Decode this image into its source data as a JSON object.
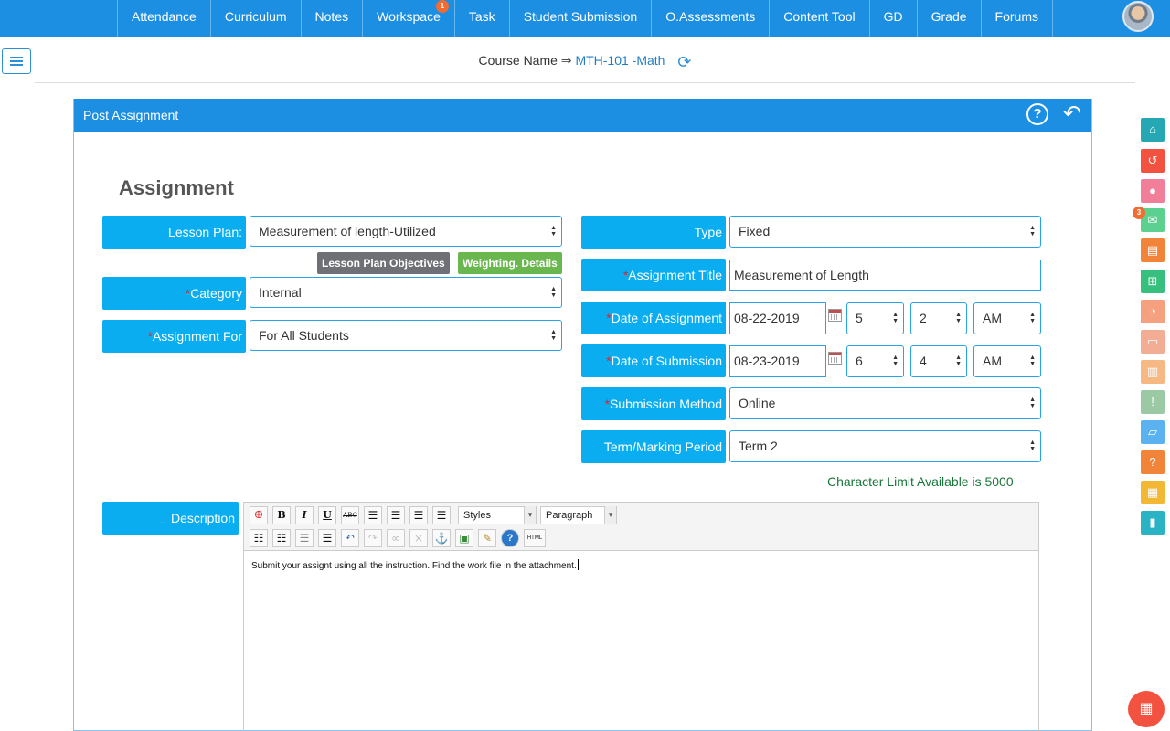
{
  "nav": {
    "items": [
      {
        "label": "Attendance"
      },
      {
        "label": "Curriculum"
      },
      {
        "label": "Notes"
      },
      {
        "label": "Workspace",
        "badge": "1"
      },
      {
        "label": "Task"
      },
      {
        "label": "Student Submission"
      },
      {
        "label": "O.Assessments"
      },
      {
        "label": "Content Tool"
      },
      {
        "label": "GD"
      },
      {
        "label": "Grade"
      },
      {
        "label": "Forums"
      }
    ],
    "avatar_icon": "user-avatar"
  },
  "course": {
    "label": "Course Name ⇒",
    "value": "MTH-101 -Math",
    "refresh_icon": "refresh-icon"
  },
  "panel": {
    "title": "Post Assignment",
    "help": "?",
    "back": "↶"
  },
  "section_title": "Assignment",
  "form": {
    "lesson_plan": {
      "label": "Lesson Plan:",
      "value": "Measurement of length-Utilized"
    },
    "objectives_tag": "Lesson Plan Objectives",
    "weighting_tag": "Weighting. Details",
    "category": {
      "required": "*",
      "label": "Category",
      "value": "Internal"
    },
    "assignment_for": {
      "required": "*",
      "label": "Assignment For",
      "value": "For All Students"
    },
    "type": {
      "label": "Type",
      "value": "Fixed"
    },
    "assignment_title": {
      "required": "*",
      "label": "Assignment Title",
      "value": "Measurement of Length"
    },
    "date_of_assignment": {
      "required": "*",
      "label": "Date of Assignment",
      "date": "08-22-2019",
      "hour": "5",
      "minute": "2",
      "ampm": "AM"
    },
    "date_of_submission": {
      "required": "*",
      "label": "Date of Submission",
      "date": "08-23-2019",
      "hour": "6",
      "minute": "4",
      "ampm": "AM"
    },
    "submission_method": {
      "required": "*",
      "label": "Submission Method",
      "value": "Online"
    },
    "term": {
      "label": "Term/Marking Period",
      "value": "Term 2"
    },
    "char_limit": "Character Limit Available is 5000",
    "description": {
      "label": "Description",
      "text": "Submit your assignt using all the instruction. Find the work file in the attachment."
    }
  },
  "editor": {
    "styles_label": "Styles",
    "paragraph_label": "Paragraph",
    "bold": "B",
    "italic": "I",
    "underline": "U",
    "strike": "ABC",
    "html": "HTML",
    "anchor": "⚓",
    "help": "?",
    "undo": "↶",
    "redo": "↷"
  },
  "dock": {
    "mail_badge": "3",
    "colors": [
      "#25a8b3",
      "#f2523f",
      "#f27f9a",
      "#5cd08e",
      "#f2843a",
      "#37c07d",
      "#f5a07f",
      "#f4ad95",
      "#f6b984",
      "#9ac9a4",
      "#5ab3f0",
      "#f2843a",
      "#f2b733",
      "#2ab3c4"
    ]
  },
  "fab_icon": "chip-icon"
}
